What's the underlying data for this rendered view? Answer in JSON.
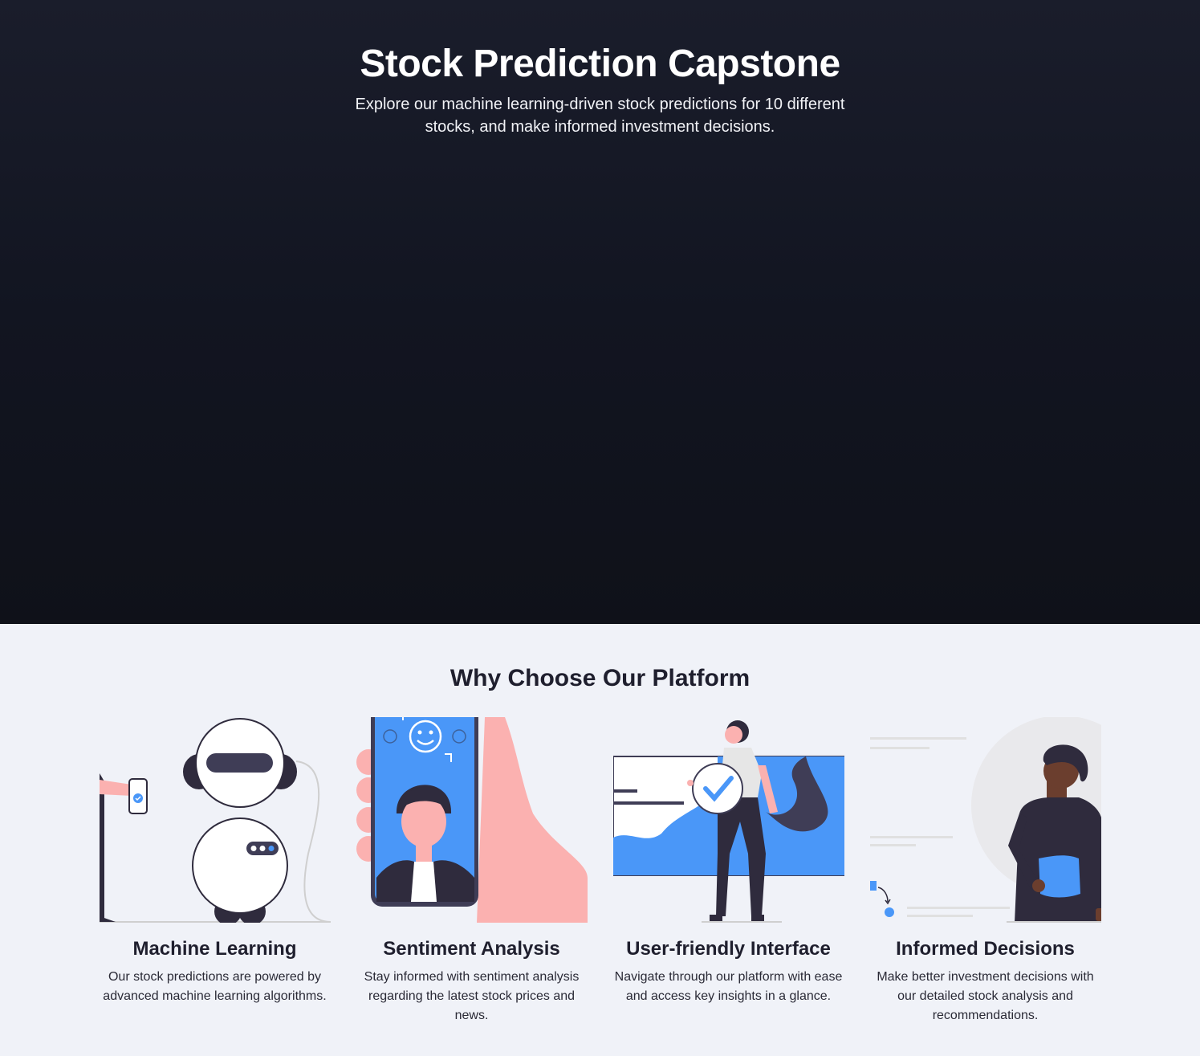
{
  "hero": {
    "title": "Stock Prediction Capstone",
    "subtitle": "Explore our machine learning-driven stock predictions for 10 different stocks, and make informed investment decisions."
  },
  "features": {
    "heading": "Why Choose Our Platform",
    "cards": [
      {
        "title": "Machine Learning",
        "description": "Our stock predictions are powered by advanced machine learning algorithms.",
        "icon": "robot-illustration"
      },
      {
        "title": "Sentiment Analysis",
        "description": "Stay informed with sentiment analysis regarding the latest stock prices and news.",
        "icon": "phone-selfie-illustration"
      },
      {
        "title": "User-friendly Interface",
        "description": "Navigate through our platform with ease and access key insights in a glance.",
        "icon": "checkmark-person-illustration"
      },
      {
        "title": "Informed Decisions",
        "description": "Make better investment decisions with our detailed stock analysis and recommendations.",
        "icon": "person-document-illustration"
      }
    ]
  },
  "colors": {
    "hero_bg": "#161926",
    "features_bg": "#f0f2f8",
    "accent_blue": "#4a97f8",
    "skin_pink": "#fbb1b0",
    "dark_purple": "#2f2b3d"
  }
}
